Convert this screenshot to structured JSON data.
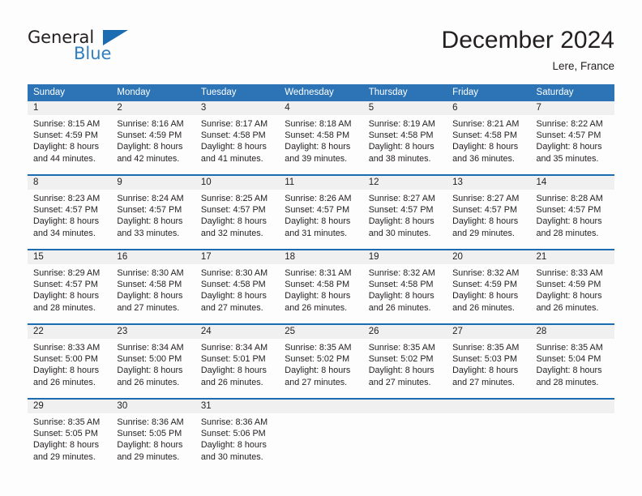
{
  "brand": {
    "word_one": "General",
    "word_two": "Blue",
    "triangle_icon": "triangle-icon"
  },
  "header": {
    "title": "December 2024",
    "location": "Lere, France"
  },
  "calendar": {
    "weekdays": [
      "Sunday",
      "Monday",
      "Tuesday",
      "Wednesday",
      "Thursday",
      "Friday",
      "Saturday"
    ],
    "accent_color": "#2d74b6",
    "separator_color": "#1b6cb0",
    "daynum_band_color": "#f0f0f0",
    "weeks": [
      [
        {
          "day": "1",
          "sunrise": "Sunrise: 8:15 AM",
          "sunset": "Sunset: 4:59 PM",
          "daylight_line1": "Daylight: 8 hours",
          "daylight_line2": "and 44 minutes."
        },
        {
          "day": "2",
          "sunrise": "Sunrise: 8:16 AM",
          "sunset": "Sunset: 4:59 PM",
          "daylight_line1": "Daylight: 8 hours",
          "daylight_line2": "and 42 minutes."
        },
        {
          "day": "3",
          "sunrise": "Sunrise: 8:17 AM",
          "sunset": "Sunset: 4:58 PM",
          "daylight_line1": "Daylight: 8 hours",
          "daylight_line2": "and 41 minutes."
        },
        {
          "day": "4",
          "sunrise": "Sunrise: 8:18 AM",
          "sunset": "Sunset: 4:58 PM",
          "daylight_line1": "Daylight: 8 hours",
          "daylight_line2": "and 39 minutes."
        },
        {
          "day": "5",
          "sunrise": "Sunrise: 8:19 AM",
          "sunset": "Sunset: 4:58 PM",
          "daylight_line1": "Daylight: 8 hours",
          "daylight_line2": "and 38 minutes."
        },
        {
          "day": "6",
          "sunrise": "Sunrise: 8:21 AM",
          "sunset": "Sunset: 4:58 PM",
          "daylight_line1": "Daylight: 8 hours",
          "daylight_line2": "and 36 minutes."
        },
        {
          "day": "7",
          "sunrise": "Sunrise: 8:22 AM",
          "sunset": "Sunset: 4:57 PM",
          "daylight_line1": "Daylight: 8 hours",
          "daylight_line2": "and 35 minutes."
        }
      ],
      [
        {
          "day": "8",
          "sunrise": "Sunrise: 8:23 AM",
          "sunset": "Sunset: 4:57 PM",
          "daylight_line1": "Daylight: 8 hours",
          "daylight_line2": "and 34 minutes."
        },
        {
          "day": "9",
          "sunrise": "Sunrise: 8:24 AM",
          "sunset": "Sunset: 4:57 PM",
          "daylight_line1": "Daylight: 8 hours",
          "daylight_line2": "and 33 minutes."
        },
        {
          "day": "10",
          "sunrise": "Sunrise: 8:25 AM",
          "sunset": "Sunset: 4:57 PM",
          "daylight_line1": "Daylight: 8 hours",
          "daylight_line2": "and 32 minutes."
        },
        {
          "day": "11",
          "sunrise": "Sunrise: 8:26 AM",
          "sunset": "Sunset: 4:57 PM",
          "daylight_line1": "Daylight: 8 hours",
          "daylight_line2": "and 31 minutes."
        },
        {
          "day": "12",
          "sunrise": "Sunrise: 8:27 AM",
          "sunset": "Sunset: 4:57 PM",
          "daylight_line1": "Daylight: 8 hours",
          "daylight_line2": "and 30 minutes."
        },
        {
          "day": "13",
          "sunrise": "Sunrise: 8:27 AM",
          "sunset": "Sunset: 4:57 PM",
          "daylight_line1": "Daylight: 8 hours",
          "daylight_line2": "and 29 minutes."
        },
        {
          "day": "14",
          "sunrise": "Sunrise: 8:28 AM",
          "sunset": "Sunset: 4:57 PM",
          "daylight_line1": "Daylight: 8 hours",
          "daylight_line2": "and 28 minutes."
        }
      ],
      [
        {
          "day": "15",
          "sunrise": "Sunrise: 8:29 AM",
          "sunset": "Sunset: 4:57 PM",
          "daylight_line1": "Daylight: 8 hours",
          "daylight_line2": "and 28 minutes."
        },
        {
          "day": "16",
          "sunrise": "Sunrise: 8:30 AM",
          "sunset": "Sunset: 4:58 PM",
          "daylight_line1": "Daylight: 8 hours",
          "daylight_line2": "and 27 minutes."
        },
        {
          "day": "17",
          "sunrise": "Sunrise: 8:30 AM",
          "sunset": "Sunset: 4:58 PM",
          "daylight_line1": "Daylight: 8 hours",
          "daylight_line2": "and 27 minutes."
        },
        {
          "day": "18",
          "sunrise": "Sunrise: 8:31 AM",
          "sunset": "Sunset: 4:58 PM",
          "daylight_line1": "Daylight: 8 hours",
          "daylight_line2": "and 26 minutes."
        },
        {
          "day": "19",
          "sunrise": "Sunrise: 8:32 AM",
          "sunset": "Sunset: 4:58 PM",
          "daylight_line1": "Daylight: 8 hours",
          "daylight_line2": "and 26 minutes."
        },
        {
          "day": "20",
          "sunrise": "Sunrise: 8:32 AM",
          "sunset": "Sunset: 4:59 PM",
          "daylight_line1": "Daylight: 8 hours",
          "daylight_line2": "and 26 minutes."
        },
        {
          "day": "21",
          "sunrise": "Sunrise: 8:33 AM",
          "sunset": "Sunset: 4:59 PM",
          "daylight_line1": "Daylight: 8 hours",
          "daylight_line2": "and 26 minutes."
        }
      ],
      [
        {
          "day": "22",
          "sunrise": "Sunrise: 8:33 AM",
          "sunset": "Sunset: 5:00 PM",
          "daylight_line1": "Daylight: 8 hours",
          "daylight_line2": "and 26 minutes."
        },
        {
          "day": "23",
          "sunrise": "Sunrise: 8:34 AM",
          "sunset": "Sunset: 5:00 PM",
          "daylight_line1": "Daylight: 8 hours",
          "daylight_line2": "and 26 minutes."
        },
        {
          "day": "24",
          "sunrise": "Sunrise: 8:34 AM",
          "sunset": "Sunset: 5:01 PM",
          "daylight_line1": "Daylight: 8 hours",
          "daylight_line2": "and 26 minutes."
        },
        {
          "day": "25",
          "sunrise": "Sunrise: 8:35 AM",
          "sunset": "Sunset: 5:02 PM",
          "daylight_line1": "Daylight: 8 hours",
          "daylight_line2": "and 27 minutes."
        },
        {
          "day": "26",
          "sunrise": "Sunrise: 8:35 AM",
          "sunset": "Sunset: 5:02 PM",
          "daylight_line1": "Daylight: 8 hours",
          "daylight_line2": "and 27 minutes."
        },
        {
          "day": "27",
          "sunrise": "Sunrise: 8:35 AM",
          "sunset": "Sunset: 5:03 PM",
          "daylight_line1": "Daylight: 8 hours",
          "daylight_line2": "and 27 minutes."
        },
        {
          "day": "28",
          "sunrise": "Sunrise: 8:35 AM",
          "sunset": "Sunset: 5:04 PM",
          "daylight_line1": "Daylight: 8 hours",
          "daylight_line2": "and 28 minutes."
        }
      ],
      [
        {
          "day": "29",
          "sunrise": "Sunrise: 8:35 AM",
          "sunset": "Sunset: 5:05 PM",
          "daylight_line1": "Daylight: 8 hours",
          "daylight_line2": "and 29 minutes."
        },
        {
          "day": "30",
          "sunrise": "Sunrise: 8:36 AM",
          "sunset": "Sunset: 5:05 PM",
          "daylight_line1": "Daylight: 8 hours",
          "daylight_line2": "and 29 minutes."
        },
        {
          "day": "31",
          "sunrise": "Sunrise: 8:36 AM",
          "sunset": "Sunset: 5:06 PM",
          "daylight_line1": "Daylight: 8 hours",
          "daylight_line2": "and 30 minutes."
        },
        {
          "day": "",
          "sunrise": "",
          "sunset": "",
          "daylight_line1": "",
          "daylight_line2": ""
        },
        {
          "day": "",
          "sunrise": "",
          "sunset": "",
          "daylight_line1": "",
          "daylight_line2": ""
        },
        {
          "day": "",
          "sunrise": "",
          "sunset": "",
          "daylight_line1": "",
          "daylight_line2": ""
        },
        {
          "day": "",
          "sunrise": "",
          "sunset": "",
          "daylight_line1": "",
          "daylight_line2": ""
        }
      ]
    ]
  }
}
